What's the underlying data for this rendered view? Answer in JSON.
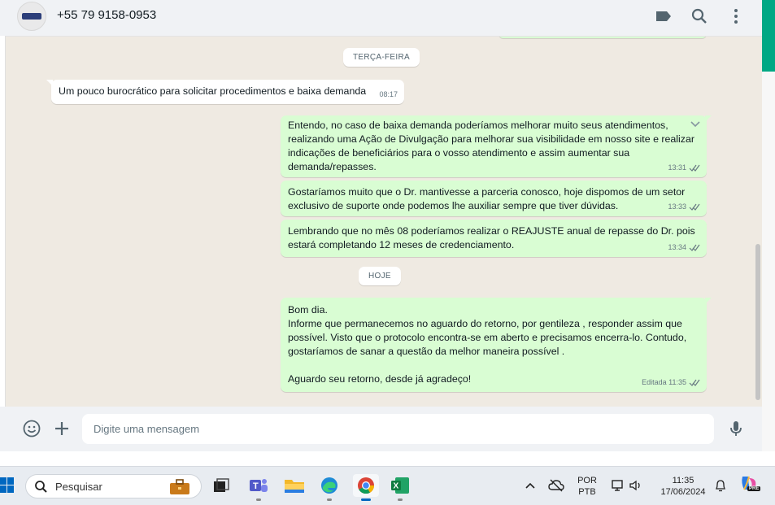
{
  "header": {
    "contact_name": "+55 79 9158-0953",
    "icons": [
      "label-icon",
      "search-icon",
      "menu-icon"
    ]
  },
  "chat": {
    "date_pills": [
      {
        "label": "TERÇA-FEIRA"
      },
      {
        "label": "HOJE"
      }
    ],
    "messages": [
      {
        "direction": "in",
        "text": "Um pouco burocrático para solicitar procedimentos e baixa demanda",
        "time": "08:17"
      },
      {
        "direction": "out",
        "text": "Entendo, no caso de baixa demanda poderíamos melhorar muito seus atendimentos,\nrealizando uma Ação de Divulgação para melhorar sua visibilidade em nosso site e realizar\nindicações de beneficiários para o vosso atendimento e assim aumentar sua\ndemanda/repasses.",
        "time": "13:31",
        "status": "read"
      },
      {
        "direction": "out",
        "text": "Gostaríamos muito que o Dr. mantivesse a parceria conosco, hoje dispomos de um setor\nexclusivo de suporte onde podemos lhe auxiliar sempre que tiver dúvidas.",
        "time": "13:33",
        "status": "read"
      },
      {
        "direction": "out",
        "text": "Lembrando que no mês 08 poderíamos realizar o REAJUSTE anual de repasse do Dr. pois\nestará completando 12 meses de credenciamento.",
        "time": "13:34",
        "status": "read"
      },
      {
        "direction": "out",
        "text": "Bom dia.\nInforme que permanecemos no aguardo do retorno, por gentileza , responder assim que\npossível. Visto que o protocolo encontra-se em aberto e precisamos encerra-lo. Contudo,\ngostaríamos de sanar a questão da melhor maneira possível .\n\nAguardo seu retorno, desde já agradeço!",
        "time": "Editada 11:35",
        "status": "read"
      }
    ]
  },
  "compose": {
    "placeholder": "Digite uma mensagem",
    "icons": [
      "emoji-icon",
      "plus-icon",
      "microphone-icon"
    ]
  },
  "taskbar": {
    "search_label": "Pesquisar",
    "lang_top": "POR",
    "lang_bottom": "PTB",
    "time": "11:35",
    "date": "17/06/2024",
    "copilot_badge": "PRE",
    "apps": [
      "briefcase-icon",
      "file-explorer-dark-icon",
      "teams-icon",
      "folder-icon",
      "edge-icon",
      "chrome-icon",
      "excel-icon"
    ]
  },
  "colors": {
    "outgoing_bubble": "#d9fdd3",
    "incoming_bubble": "#ffffff",
    "chat_background": "#efeae2",
    "accent": "#00a884",
    "read_tick": "#667781"
  }
}
